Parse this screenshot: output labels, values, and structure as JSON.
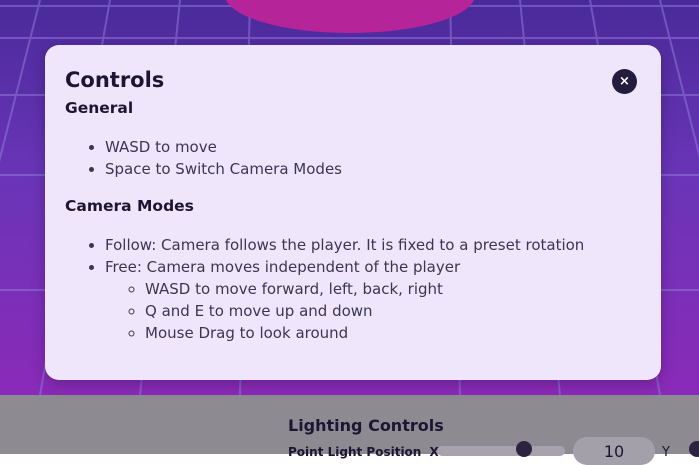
{
  "modal": {
    "title": "Controls",
    "close_label": "×",
    "general": {
      "heading": "General",
      "items": [
        "WASD to move",
        "Space to Switch Camera Modes"
      ]
    },
    "camera_modes": {
      "heading": "Camera Modes",
      "items": [
        "Follow: Camera follows the player. It is fixed to a preset rotation",
        "Free: Camera moves independent of the player"
      ],
      "free_subitems": [
        "WASD to move forward, left, back, right",
        "Q and E to move up and down",
        "Mouse Drag to look around"
      ]
    }
  },
  "lighting_panel": {
    "title": "Lighting Controls",
    "point_light_label": "Point Light Position",
    "axis_x": "X",
    "x_value": "10",
    "axis_y": "Y"
  },
  "colors": {
    "modal_background": "#efe6fb",
    "close_button": "#231c3d",
    "scene_grid": "#8a6fd0",
    "panel_background": "#8e8a92"
  }
}
